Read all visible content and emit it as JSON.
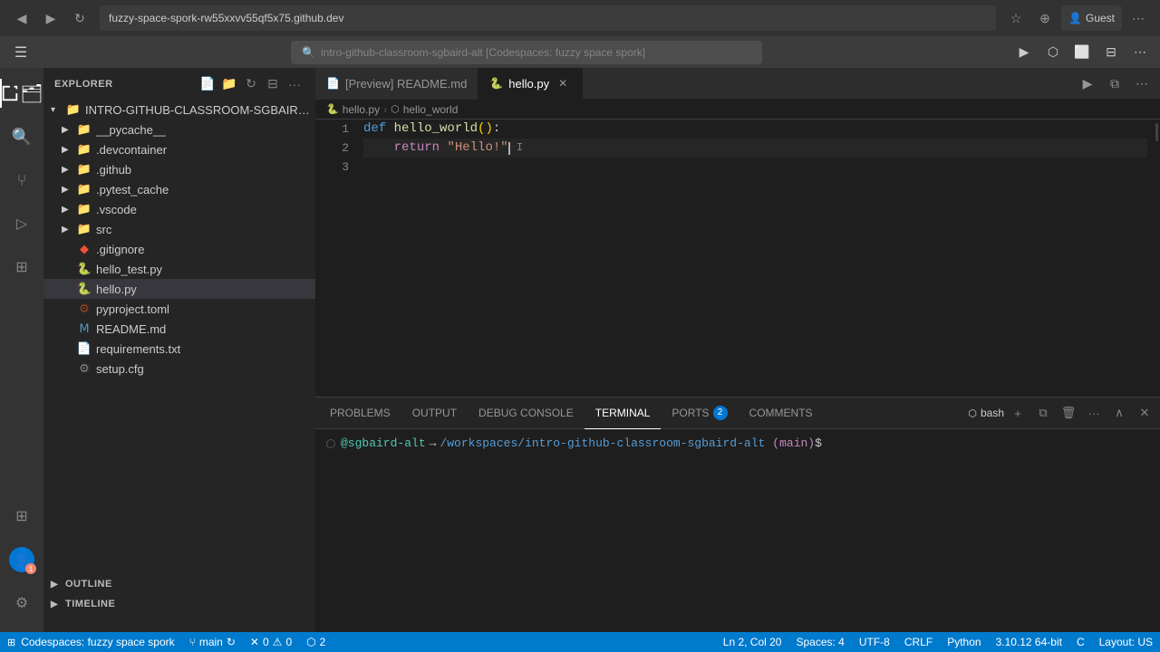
{
  "browser": {
    "url": "fuzzy-space-spork-rw55xxvv55qf5x75.github.dev",
    "back_btn": "◀",
    "forward_btn": "▶",
    "refresh_btn": "↻",
    "search_label": "🔍",
    "tab_title": "intro-github-classroom-sgbaird-alt [Codespaces: fuzzy space spork]",
    "guest_label": "Guest",
    "more_btn": "⋯",
    "bookmark_btn": "⭐",
    "profile_btn": "👤"
  },
  "title_bar": {
    "hamburger": "☰",
    "search_placeholder": "intro-github-classroom-sgbaird-alt [Codespaces: fuzzy space spork]",
    "run_btn": "▶",
    "more_btn": "⋯",
    "layout_btn_1": "⬜",
    "layout_btn_2": "⬜",
    "layout_btn_3": "⬜",
    "layout_btn_more": "⋯"
  },
  "sidebar": {
    "title": "EXPLORER",
    "more_btn": "···",
    "root_folder": "INTRO-GITHUB-CLASSROOM-SGBAIRD-ALT [CODES...",
    "items": [
      {
        "name": "__pycache__",
        "type": "folder",
        "indent": 1,
        "expanded": false
      },
      {
        "name": ".devcontainer",
        "type": "folder",
        "indent": 1,
        "expanded": false
      },
      {
        "name": ".github",
        "type": "folder",
        "indent": 1,
        "expanded": false
      },
      {
        "name": ".pytest_cache",
        "type": "folder",
        "indent": 1,
        "expanded": false
      },
      {
        "name": ".vscode",
        "type": "folder",
        "indent": 1,
        "expanded": false
      },
      {
        "name": "src",
        "type": "folder",
        "indent": 1,
        "expanded": false
      },
      {
        "name": ".gitignore",
        "type": "gitignore",
        "indent": 1
      },
      {
        "name": "hello_test.py",
        "type": "python",
        "indent": 1
      },
      {
        "name": "hello.py",
        "type": "python",
        "indent": 1,
        "active": true
      },
      {
        "name": "pyproject.toml",
        "type": "toml",
        "indent": 1
      },
      {
        "name": "README.md",
        "type": "markdown",
        "indent": 1
      },
      {
        "name": "requirements.txt",
        "type": "text",
        "indent": 1
      },
      {
        "name": "setup.cfg",
        "type": "config",
        "indent": 1
      }
    ],
    "outline_label": "OUTLINE",
    "timeline_label": "TIMELINE"
  },
  "tabs": [
    {
      "label": "[Preview] README.md",
      "icon": "📄",
      "active": false,
      "closeable": false
    },
    {
      "label": "hello.py",
      "icon": "🐍",
      "active": true,
      "closeable": true
    }
  ],
  "breadcrumb": {
    "file": "hello.py",
    "symbol": "hello_world",
    "file_icon": "🐍",
    "symbol_icon": "⬡"
  },
  "code": {
    "lines": [
      {
        "num": 1,
        "content": "def hello_world():"
      },
      {
        "num": 2,
        "content": "    return \"Hello!\"",
        "cursor": true
      },
      {
        "num": 3,
        "content": ""
      }
    ]
  },
  "terminal_panel": {
    "tabs": [
      {
        "label": "PROBLEMS",
        "active": false,
        "badge": null
      },
      {
        "label": "OUTPUT",
        "active": false,
        "badge": null
      },
      {
        "label": "DEBUG CONSOLE",
        "active": false,
        "badge": null
      },
      {
        "label": "TERMINAL",
        "active": true,
        "badge": null
      },
      {
        "label": "PORTS",
        "active": false,
        "badge": "2"
      },
      {
        "label": "COMMENTS",
        "active": false,
        "badge": null
      }
    ],
    "bash_label": "bash",
    "add_btn": "+",
    "split_btn": "⧉",
    "trash_btn": "🗑",
    "more_btn": "···",
    "maximize_btn": "∧",
    "close_btn": "✕",
    "prompt": {
      "user": "@sgbaird-alt",
      "arrow": "→",
      "path": "/workspaces/intro-github-classroom-sgbaird-alt",
      "branch": "(main)",
      "dollar": "$"
    }
  },
  "status_bar": {
    "codespaces_label": "Codespaces: fuzzy space spork",
    "branch": "main",
    "sync_icon": "↻",
    "errors": "0",
    "warnings": "0",
    "ports_count": "2",
    "ports_icon": "⬡",
    "ln_col": "Ln 2, Col 20",
    "spaces": "Spaces: 4",
    "encoding": "UTF-8",
    "line_ending": "CRLF",
    "language": "Python",
    "python_version": "3.10.12 64-bit",
    "layout": "C",
    "layout2": "Layout: US"
  },
  "activity_bar": {
    "items": [
      {
        "name": "explorer",
        "icon": "📄",
        "active": true
      },
      {
        "name": "search",
        "icon": "🔍",
        "active": false
      },
      {
        "name": "source-control",
        "icon": "⑂",
        "active": false
      },
      {
        "name": "run-debug",
        "icon": "▷",
        "active": false
      },
      {
        "name": "extensions",
        "icon": "⊞",
        "active": false
      }
    ],
    "bottom": [
      {
        "name": "remote",
        "icon": "⊞"
      },
      {
        "name": "accounts",
        "icon": "👤",
        "badge": "1"
      },
      {
        "name": "settings",
        "icon": "⚙"
      }
    ]
  }
}
